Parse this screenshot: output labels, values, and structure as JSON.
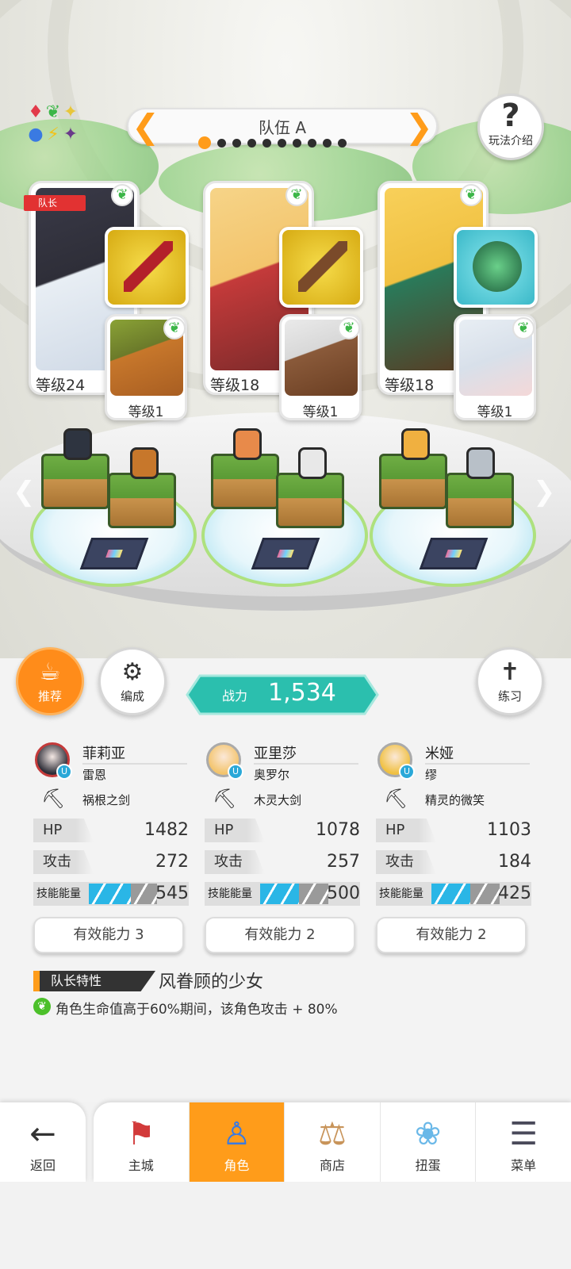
{
  "header": {
    "team_title": "队伍 A",
    "team_pages": 10,
    "active_team_index": 0,
    "help_label": "玩法介绍"
  },
  "element_icons": [
    "diamond-red-icon",
    "leaf-green-icon",
    "star-yellow-icon",
    "circle-blue-icon",
    "bolt-yellow-icon",
    "star-purple-icon"
  ],
  "heroes": [
    {
      "captain_tag": "队长",
      "main_level": "等级24",
      "sub_level": "等级1",
      "portrait_color": "#2e2e38",
      "weapon_bg": "#e6c21a",
      "weapon_color": "#b3202a",
      "sub_color": "#c7772b"
    },
    {
      "main_level": "等级18",
      "sub_level": "等级1",
      "portrait_color": "#f3c46c",
      "weapon_bg": "#e6c21a",
      "weapon_color": "#7a4a2a",
      "sub_color": "#8a5a3a"
    },
    {
      "main_level": "等级18",
      "sub_level": "等级1",
      "portrait_color": "#f0c040",
      "weapon_bg": "#5ed0d8",
      "weapon_color": "#3a8a5a",
      "sub_color": "#d8e0ea"
    }
  ],
  "actions": {
    "recommend_label": "推荐",
    "formation_label": "编成",
    "practice_label": "练习",
    "power_label": "战力",
    "power_value": "1,534"
  },
  "details": [
    {
      "name": "菲莉亚",
      "sub_name": "雷恩",
      "weapon": "祸根之剑",
      "hp_label": "HP",
      "hp": "1482",
      "atk_label": "攻击",
      "atk": "272",
      "energy_label": "技能能量",
      "energy": "545",
      "energy_fraction": 0.62,
      "ability_label": "有效能力 3"
    },
    {
      "name": "亚里莎",
      "sub_name": "奥罗尔",
      "weapon": "木灵大剑",
      "hp_label": "HP",
      "hp": "1078",
      "atk_label": "攻击",
      "atk": "257",
      "energy_label": "技能能量",
      "energy": "500",
      "energy_fraction": 0.57,
      "ability_label": "有效能力 2"
    },
    {
      "name": "米娅",
      "sub_name": "缪",
      "weapon": "精灵的微笑",
      "hp_label": "HP",
      "hp": "1103",
      "atk_label": "攻击",
      "atk": "184",
      "energy_label": "技能能量",
      "energy": "425",
      "energy_fraction": 0.57,
      "ability_label": "有效能力 2"
    }
  ],
  "captain_trait": {
    "tag": "队长特性",
    "name": "风眷顾的少女",
    "description": "角色生命值高于60%期间，该角色攻击 + 80%"
  },
  "nav": {
    "back_label": "返回",
    "items": [
      {
        "label": "主城",
        "icon": "castle-icon"
      },
      {
        "label": "角色",
        "icon": "character-icon",
        "active": true
      },
      {
        "label": "商店",
        "icon": "shop-icon"
      },
      {
        "label": "扭蛋",
        "icon": "gacha-icon"
      },
      {
        "label": "菜单",
        "icon": "menu-icon"
      }
    ]
  },
  "colors": {
    "accent": "#ff9c1a",
    "power_teal": "#2bbfae",
    "energy_blue": "#2ab6e6",
    "leaf_green": "#3cb648"
  }
}
